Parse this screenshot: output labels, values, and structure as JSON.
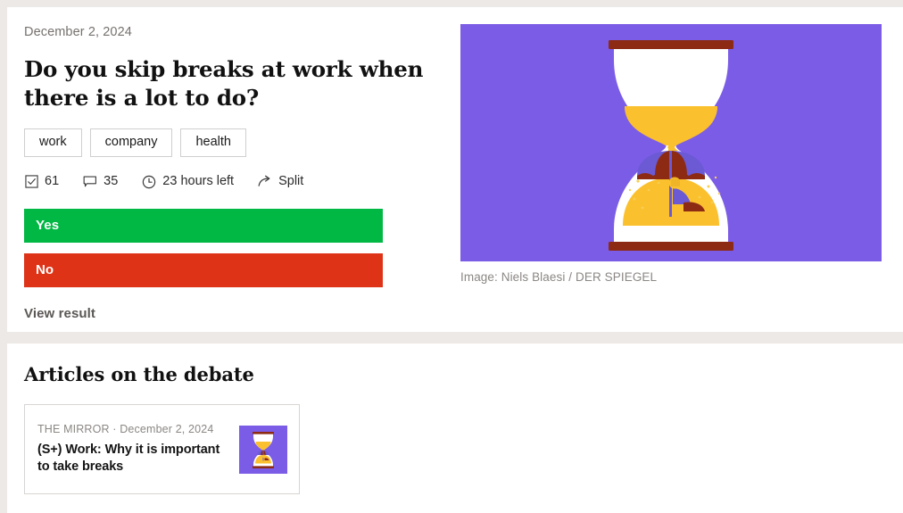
{
  "theme": {
    "page_background": "#ece9e7",
    "panel_background": "#ffffff",
    "accent_purple": "#7b5ce6",
    "yes_green": "#00b843",
    "no_red": "#df3317",
    "sand_yellow": "#fbc02d",
    "umbrella_dark_red": "#8c2a14",
    "muted_text": "#8b8784"
  },
  "poll": {
    "date": "December 2, 2024",
    "title": "Do you skip breaks at work when there is a lot to do?",
    "tags": [
      {
        "label": "work"
      },
      {
        "label": "company"
      },
      {
        "label": "health"
      }
    ],
    "meta": {
      "votes_icon": "checkbox-checked-icon",
      "votes_count": "61",
      "comments_icon": "comment-bubble-icon",
      "comments_count": "35",
      "time_icon": "clock-icon",
      "time_left": "23 hours left",
      "share_icon": "share-arrow-icon",
      "share_label": "Split"
    },
    "options": [
      {
        "label": "Yes",
        "color": "#00b843"
      },
      {
        "label": "No",
        "color": "#df3317"
      }
    ],
    "view_result_label": "View result",
    "image": {
      "alt_name": "hourglass-illustration",
      "background_color": "#7b5ce6",
      "caption": "Image: Niels Blaesi / DER SPIEGEL"
    }
  },
  "articles": {
    "heading": "Articles on the debate",
    "items": [
      {
        "source": "THE MIRROR · December 2, 2024",
        "headline": "(S+) Work: Why it is important to take breaks",
        "thumb_name": "hourglass-thumbnail"
      }
    ]
  }
}
